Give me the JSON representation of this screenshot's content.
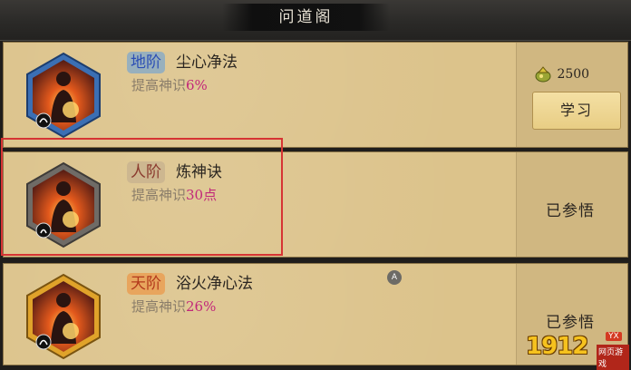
{
  "header": {
    "title": "问道阁"
  },
  "skills": [
    {
      "tier": "地阶",
      "name": "尘心净法",
      "effect_label": "提高神识",
      "effect_value": "6%",
      "cost": "2500",
      "action_label": "学习",
      "frame_color": "#3b6fb4"
    },
    {
      "tier": "人阶",
      "name": "炼神诀",
      "effect_label": "提高神识",
      "effect_value": "30点",
      "status": "已参悟",
      "frame_color": "#6f6b66"
    },
    {
      "tier": "天阶",
      "name": "浴火净心法",
      "effect_label": "提高神识",
      "effect_value": "26%",
      "status": "已参悟",
      "frame_color": "#e0a32a"
    }
  ],
  "overlay": {
    "marker": "A"
  },
  "watermark": {
    "main": "1912",
    "yx": "YX",
    "sub": "网页游戏"
  },
  "icons": {
    "currency": "spirit-stone-icon",
    "emblem": "meditating-figure-flame-icon"
  }
}
